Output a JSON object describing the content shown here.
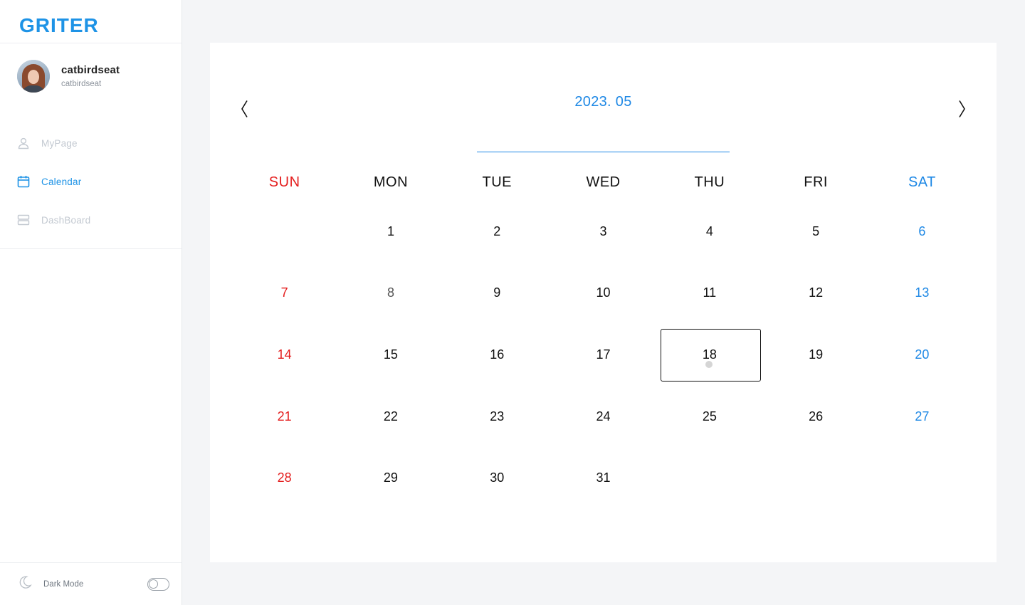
{
  "brand": "GRITER",
  "profile": {
    "name": "catbirdseat",
    "id": "catbirdseat"
  },
  "nav": [
    {
      "label": "MyPage",
      "icon": "user-icon",
      "active": false
    },
    {
      "label": "Calendar",
      "icon": "calendar-icon",
      "active": true
    },
    {
      "label": "DashBoard",
      "icon": "dashboard-icon",
      "active": false
    }
  ],
  "footer": {
    "dark_mode_label": "Dark Mode",
    "dark_mode_on": false
  },
  "calendar": {
    "month_label": "2023. 05",
    "weekdays": [
      "SUN",
      "MON",
      "TUE",
      "WED",
      "THU",
      "FRI",
      "SAT"
    ],
    "weeks": [
      [
        "",
        "1",
        "2",
        "3",
        "4",
        "5",
        "6"
      ],
      [
        "7",
        "8",
        "9",
        "10",
        "11",
        "12",
        "13"
      ],
      [
        "14",
        "15",
        "16",
        "17",
        "18",
        "19",
        "20"
      ],
      [
        "21",
        "22",
        "23",
        "24",
        "25",
        "26",
        "27"
      ],
      [
        "28",
        "29",
        "30",
        "31",
        "",
        "",
        ""
      ]
    ],
    "selected_day": "18",
    "days_with_entries": [
      "18"
    ]
  },
  "colors": {
    "accent": "#1e93e6",
    "sunday": "#e41e1e",
    "saturday": "#1e88e5",
    "inactive_nav": "#c3c9d1",
    "page_bg": "#f4f5f7"
  }
}
